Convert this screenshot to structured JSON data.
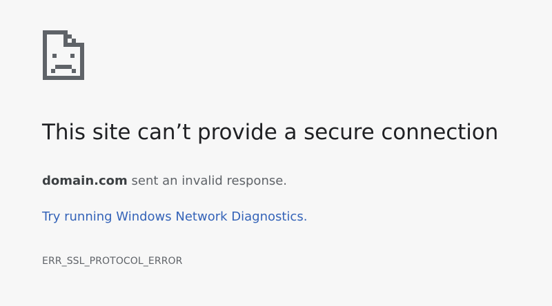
{
  "icon": "sad-document-icon",
  "colors": {
    "background": "#f7f7f7",
    "title": "#202124",
    "text": "#5f6368",
    "link": "#3463b8"
  },
  "error": {
    "title": "This site can’t provide a secure connection",
    "domain": "domain.com",
    "message": " sent an invalid response.",
    "diagnostics_link": "Try running Windows Network Diagnostics.",
    "code": "ERR_SSL_PROTOCOL_ERROR"
  }
}
